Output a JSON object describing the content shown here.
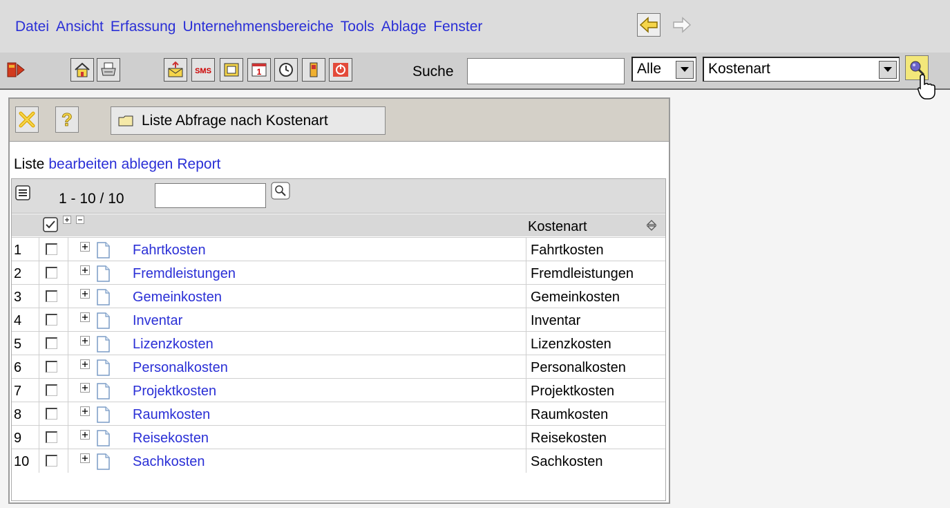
{
  "menu": {
    "items": [
      "Datei",
      "Ansicht",
      "Erfassung",
      "Unternehmensbereiche",
      "Tools",
      "Ablage",
      "Fenster"
    ]
  },
  "toolbar": {
    "search_label": "Suche",
    "search_value": "",
    "filter_select": "Alle",
    "type_select": "Kostenart"
  },
  "panel": {
    "title": "Liste Abfrage nach Kostenart",
    "action_prefix": "Liste",
    "actions": [
      "bearbeiten",
      "ablegen",
      "Report"
    ],
    "pager_range": "1 - 10 / 10",
    "filter_value": "",
    "column_header": "Kostenart",
    "rows": [
      {
        "num": "1",
        "name": "Fahrtkosten",
        "type": "Fahrtkosten"
      },
      {
        "num": "2",
        "name": "Fremdleistungen",
        "type": "Fremdleistungen"
      },
      {
        "num": "3",
        "name": "Gemeinkosten",
        "type": "Gemeinkosten"
      },
      {
        "num": "4",
        "name": "Inventar",
        "type": "Inventar"
      },
      {
        "num": "5",
        "name": "Lizenzkosten",
        "type": "Lizenzkosten"
      },
      {
        "num": "6",
        "name": "Personalkosten",
        "type": "Personalkosten"
      },
      {
        "num": "7",
        "name": "Projektkosten",
        "type": "Projektkosten"
      },
      {
        "num": "8",
        "name": "Raumkosten",
        "type": "Raumkosten"
      },
      {
        "num": "9",
        "name": "Reisekosten",
        "type": "Reisekosten"
      },
      {
        "num": "10",
        "name": "Sachkosten",
        "type": "Sachkosten"
      }
    ]
  },
  "colors": {
    "link": "#2a2fd6",
    "menubar_bg": "#dcdcdc",
    "toolbar_bg": "#cfcfcf",
    "panel_header_bg": "#d4d0c8"
  },
  "icons": [
    "exit-icon",
    "home-icon",
    "print-icon",
    "mail-icon",
    "sms-icon",
    "window-icon",
    "calendar-icon",
    "clock-icon",
    "database-icon",
    "power-icon",
    "close-icon",
    "help-icon",
    "folder-icon",
    "list-icon",
    "magnifier-icon"
  ]
}
